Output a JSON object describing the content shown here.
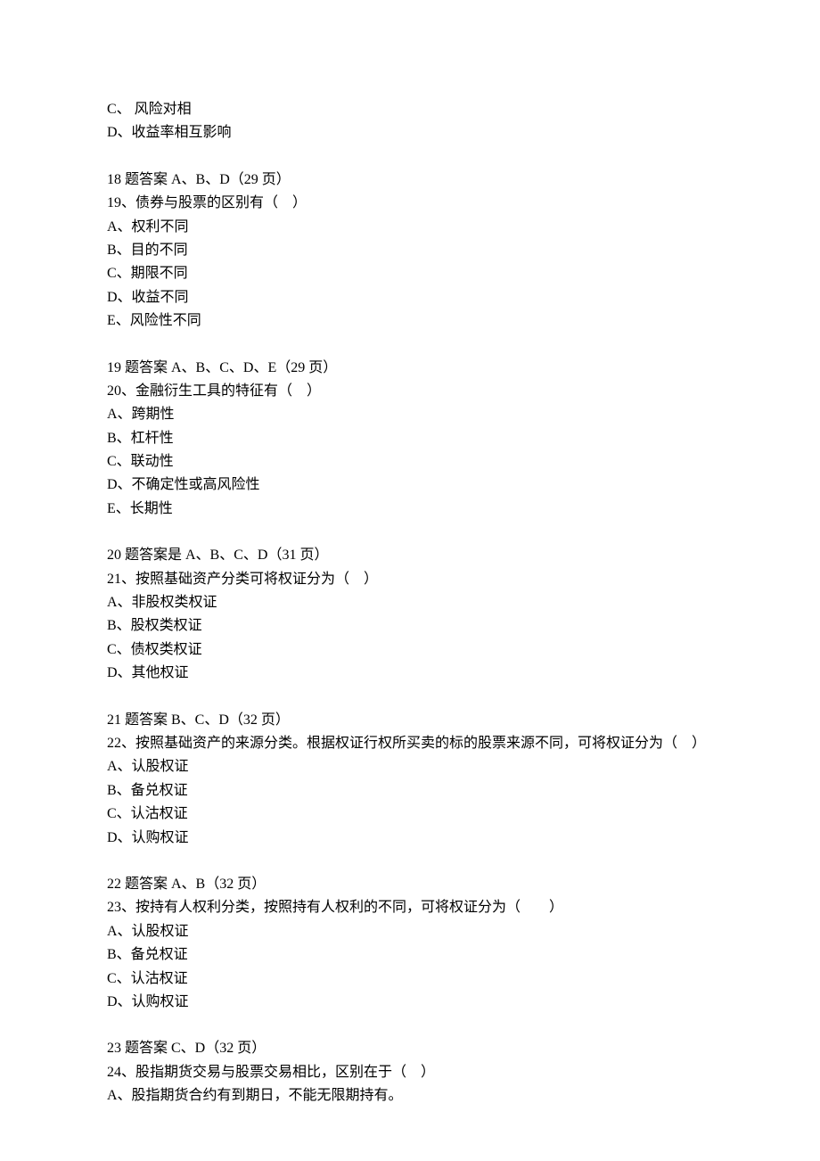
{
  "lines": [
    {
      "type": "text",
      "value": "C、 风险对相"
    },
    {
      "type": "text",
      "value": "D、收益率相互影响"
    },
    {
      "type": "blank"
    },
    {
      "type": "text",
      "value": "18 题答案 A、B、D（29 页）"
    },
    {
      "type": "text",
      "value": "19、债券与股票的区别有（　）"
    },
    {
      "type": "text",
      "value": "A、权利不同"
    },
    {
      "type": "text",
      "value": "B、目的不同"
    },
    {
      "type": "text",
      "value": "C、期限不同"
    },
    {
      "type": "text",
      "value": "D、收益不同"
    },
    {
      "type": "text",
      "value": "E、风险性不同"
    },
    {
      "type": "blank"
    },
    {
      "type": "text",
      "value": "19 题答案 A、B、C、D、E（29 页）"
    },
    {
      "type": "text",
      "value": "20、金融衍生工具的特征有（　）"
    },
    {
      "type": "text",
      "value": "A、跨期性"
    },
    {
      "type": "text",
      "value": "B、杠杆性"
    },
    {
      "type": "text",
      "value": "C、联动性"
    },
    {
      "type": "text",
      "value": "D、不确定性或高风险性"
    },
    {
      "type": "text",
      "value": "E、长期性"
    },
    {
      "type": "blank"
    },
    {
      "type": "text",
      "value": "20 题答案是 A、B、C、D（31 页）"
    },
    {
      "type": "text",
      "value": "21、按照基础资产分类可将权证分为（　）"
    },
    {
      "type": "text",
      "value": "A、非股权类权证"
    },
    {
      "type": "text",
      "value": "B、股权类权证"
    },
    {
      "type": "text",
      "value": "C、债权类权证"
    },
    {
      "type": "text",
      "value": "D、其他权证"
    },
    {
      "type": "blank"
    },
    {
      "type": "text",
      "value": "21 题答案 B、C、D（32 页）"
    },
    {
      "type": "text",
      "value": "22、按照基础资产的来源分类。根据权证行权所买卖的标的股票来源不同，可将权证分为（　）"
    },
    {
      "type": "text",
      "value": "A、认股权证"
    },
    {
      "type": "text",
      "value": "B、备兑权证"
    },
    {
      "type": "text",
      "value": "C、认沽权证"
    },
    {
      "type": "text",
      "value": "D、认购权证"
    },
    {
      "type": "blank"
    },
    {
      "type": "text",
      "value": "22 题答案 A、B（32 页）"
    },
    {
      "type": "text",
      "value": "23、按持有人权利分类，按照持有人权利的不同，可将权证分为（　　）"
    },
    {
      "type": "text",
      "value": "A、认股权证"
    },
    {
      "type": "text",
      "value": "B、备兑权证"
    },
    {
      "type": "text",
      "value": "C、认沽权证"
    },
    {
      "type": "text",
      "value": "D、认购权证"
    },
    {
      "type": "blank"
    },
    {
      "type": "text",
      "value": "23 题答案 C、D（32 页）"
    },
    {
      "type": "text",
      "value": "24、股指期货交易与股票交易相比，区别在于（　）"
    },
    {
      "type": "text",
      "value": "A、股指期货合约有到期日，不能无限期持有。"
    }
  ]
}
